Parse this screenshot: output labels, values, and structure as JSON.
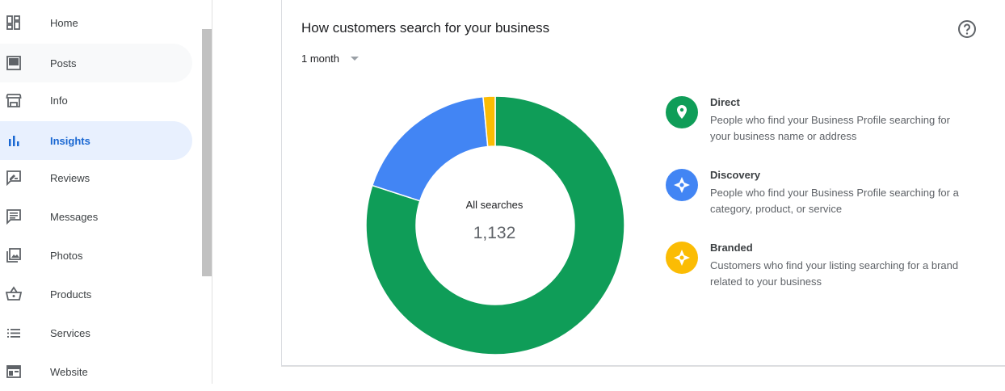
{
  "sidebar": {
    "items": [
      {
        "label": "Home",
        "icon": "dashboard-icon"
      },
      {
        "label": "Posts",
        "icon": "posts-icon"
      },
      {
        "label": "Info",
        "icon": "storefront-icon"
      },
      {
        "label": "Insights",
        "icon": "bar-chart-icon"
      },
      {
        "label": "Reviews",
        "icon": "rate-review-icon"
      },
      {
        "label": "Messages",
        "icon": "message-icon"
      },
      {
        "label": "Photos",
        "icon": "photo-library-icon"
      },
      {
        "label": "Products",
        "icon": "shopping-basket-icon"
      },
      {
        "label": "Services",
        "icon": "list-icon"
      },
      {
        "label": "Website",
        "icon": "web-icon"
      }
    ],
    "active": "Insights"
  },
  "card": {
    "title": "How customers search for your business",
    "period": "1 month",
    "help_icon": "help-icon"
  },
  "chart_data": {
    "type": "pie",
    "center_label": "All searches",
    "total": "1,132",
    "series": [
      {
        "name": "Direct",
        "value": 0.8,
        "color": "#0f9d58"
      },
      {
        "name": "Discovery",
        "value": 0.185,
        "color": "#4285f4"
      },
      {
        "name": "Branded",
        "value": 0.015,
        "color": "#fbbc04"
      }
    ]
  },
  "legend": [
    {
      "name": "Direct",
      "description": "People who find your Business Profile searching for your business name or address",
      "color": "#0f9d58",
      "icon": "location-pin-icon"
    },
    {
      "name": "Discovery",
      "description": "People who find your Business Profile searching for a category, product, or service",
      "color": "#4285f4",
      "icon": "discovery-icon"
    },
    {
      "name": "Branded",
      "description": "Customers who find your listing searching for a brand related to your business",
      "color": "#fbbc04",
      "icon": "branded-icon"
    }
  ]
}
